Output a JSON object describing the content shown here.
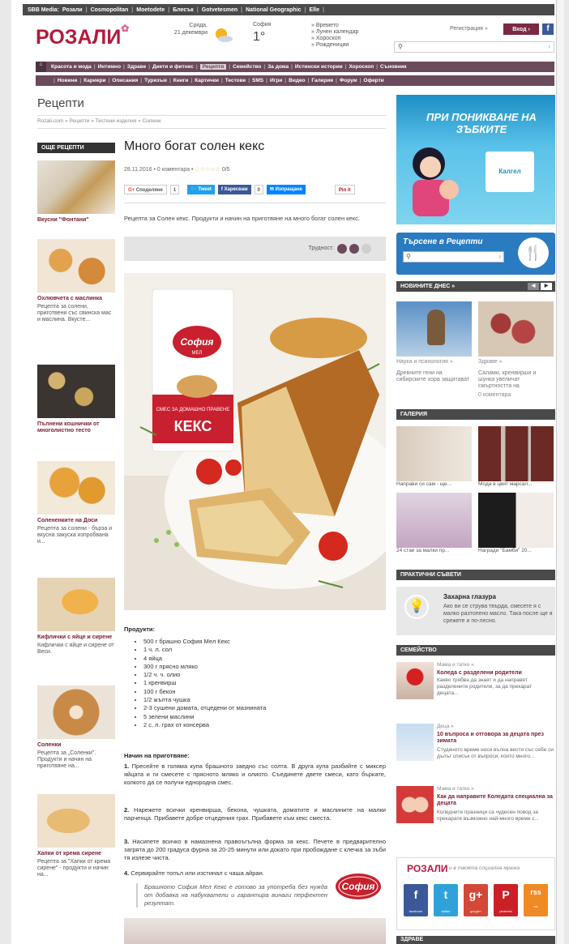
{
  "media_bar": [
    "SBB Media:",
    "Розали",
    "Cosmopolitan",
    "Moetodete",
    "Блесък",
    "Gotvetesmen",
    "National Geographic",
    "Elle"
  ],
  "logo": "РОЗАЛИ",
  "weather": {
    "day": "Сряда,",
    "date": "21 декември",
    "city": "София",
    "temp": "1°"
  },
  "header_links": [
    "» Времето",
    "» Лунен календар",
    "» Хороскоп",
    "» Рождениции"
  ],
  "register": "Регистрация »",
  "login": "Вход",
  "fb": "f",
  "nav_main": [
    "Красота и мода",
    "Интимно",
    "Здраве",
    "Диети и фитнес",
    "Рецепти",
    "Семейство",
    "За дома",
    "Истински истории",
    "Хороскоп",
    "Съновник"
  ],
  "nav_sub": [
    "Новини",
    "Кариери",
    "Описания",
    "Туризъм",
    "Книги",
    "Картички",
    "Тестове",
    "SMS",
    "Игри",
    "Видео",
    "Галерия",
    "Форум",
    "Оферти"
  ],
  "page_title": "Рецепти",
  "breadcrumb": "Rozali.com » Рецепти » Тестени изделия » Солени",
  "sidebar_title": "ОЩЕ РЕЦЕПТИ",
  "sidebar": [
    {
      "title": "Вкусни \"Фонтани\"",
      "desc": ""
    },
    {
      "title": "Охлювчета с маслинка",
      "desc": "Рецепта за солени, приготвени със свинска мас и маслина. Вкусте..."
    },
    {
      "title": "Пълнени кошнички от многолистно тесто",
      "desc": ""
    },
    {
      "title": "Солененките на Доси",
      "desc": "Рецепта за солени - бърза и вкусна закуска изпробвана и..."
    },
    {
      "title": "Кифлички с яйце и сирене",
      "desc": "Кифлички с яйце и сирене от Веси."
    },
    {
      "title": "Соленки",
      "desc": "Рецепта за „Соленки\". Продукти и начин на приготвяне на..."
    },
    {
      "title": "Хапки от крема сирене",
      "desc": "Рецепта за \"Хапки от крема сирене\" - продукти и начин на..."
    }
  ],
  "article": {
    "title": "Много богат солен кекс",
    "meta": "28.11.2016 • 0 коментара •",
    "stars": "☆☆☆☆☆",
    "rating": "0/5",
    "share": {
      "google": "Споделяне",
      "google_count": "1",
      "twitter": "Tweet",
      "facebook": "Харесвам",
      "fb_count": "0",
      "messenger": "Изпращане",
      "pin": "Pin it"
    },
    "intro": "Рецепта за Солен кекс. Продукти и начин на приготвяне на много богат солен кекс.",
    "difficulty_label": "Трудност:",
    "image": {
      "brand": "София",
      "brand_sub": "МЕЛ",
      "product": "КЕКС",
      "product_sub": "СМЕС ЗА ДОМАШНО ПРАВЕНЕ"
    },
    "products_title": "Продукти:",
    "ingredients": [
      "500 г брашно София Мел Кекс",
      "1 ч. л. сол",
      "4 яйца",
      "300 г прясно мляко",
      "1/2 ч. ч. олио",
      "1 кренвирш",
      "100 г бекон",
      "1/2 жълта чушка",
      "2-3 сушени домата, отцедени от мазнината",
      "5 зелени маслини",
      "2 с. л. грах от консерва"
    ],
    "method_title": "Начин на приготвяне:",
    "steps": [
      {
        "n": "1.",
        "text": "Пресейте в голяма купа брашното заедно със солта. В друга купа разбийте с миксер яйцата и ги смесете с прясното мляко и олиото. Съединете двете смеси, като бъркате, колкото да се получи еднородна смес."
      },
      {
        "n": "2.",
        "text": "Нарежете всички кренвирша, бекона, чушката, доматите и маслините на малки парченца. Прибавете добре отцедения грах. Прибавете към кекс сместа."
      },
      {
        "n": "3.",
        "text": "Насипете всичко в намазнена правоъгълна форма за кекс. Печете в предварително загрята до 200 градуса фурна за 20-25 минути или докато при пробождане с клечка за зъби тя излезе чиста."
      },
      {
        "n": "4.",
        "text": "Сервирайте топъл или изстинал с чаша айран."
      }
    ],
    "note": "Брашното София Мел Кекс е готово за употреба без нужда от добавка на набухватели и гарантира винаги перфектен резултат.",
    "note_logo": "София"
  },
  "ad": {
    "text": "ПРИ ПОНИКВАНЕ НА ЗЪБКИТЕ",
    "brand": "Калгел"
  },
  "recipe_search": {
    "title": "Търсене в Рецепти",
    "placeholder": ""
  },
  "news": {
    "title": "НОВИНИТЕ ДНЕС »",
    "items": [
      {
        "cat": "Наука и психология »",
        "title": "Древните гени на сибирските хора защитават"
      },
      {
        "cat": "Здраве »",
        "title": "Салами, кренвирши и шунка увеличат смъртността на",
        "comments": "0 коментара"
      }
    ]
  },
  "gallery": {
    "title": "ГАЛЕРИЯ",
    "items": [
      "Направи си сам - ще...",
      "Мода в цвят марсал...",
      "24 стаи за малки пр...",
      "Награди \"Бамби\" 20..."
    ]
  },
  "tips": {
    "title": "ПРАКТИЧНИ СЪВЕТИ",
    "item_title": "Захарна глазура",
    "item_desc": "Ако ви се струва твърда, смесете я с малко разтопено масло. Така после ще я срежете и по-лесно."
  },
  "family": {
    "title": "СЕМЕЙСТВО",
    "items": [
      {
        "cat": "Мама и татко »",
        "title": "Коледа с разделени родители",
        "desc": "Какво трябва да знаят и да направят разделените родители, за да прекарат децата..."
      },
      {
        "cat": "Деца »",
        "title": "10 въпроса и отговора за децата през зимата",
        "desc": "Студеното време носи вълна вести със себе си дълъг списък от въпроси, които много..."
      },
      {
        "cat": "Мама и татко »",
        "title": "Как да направите Коледата специална за децата",
        "desc": "Коледните празници са чудесен повод за прекарате възможно най-много време с..."
      }
    ]
  },
  "social": {
    "title": "РОЗАЛИ",
    "sub": "и в твоята социална мрежа",
    "items": [
      {
        "icon": "f",
        "label": "facebook"
      },
      {
        "icon": "t",
        "label": "twitter"
      },
      {
        "icon": "g+",
        "label": "google+"
      },
      {
        "icon": "P",
        "label": "pinterest"
      },
      {
        "icon": "rss",
        "label": "rss"
      }
    ]
  },
  "health_title": "ЗДРАВЕ",
  "colors": {
    "brand": "#b5193d",
    "nav": "#6b4a5b",
    "blue": "#2a7bc0"
  }
}
